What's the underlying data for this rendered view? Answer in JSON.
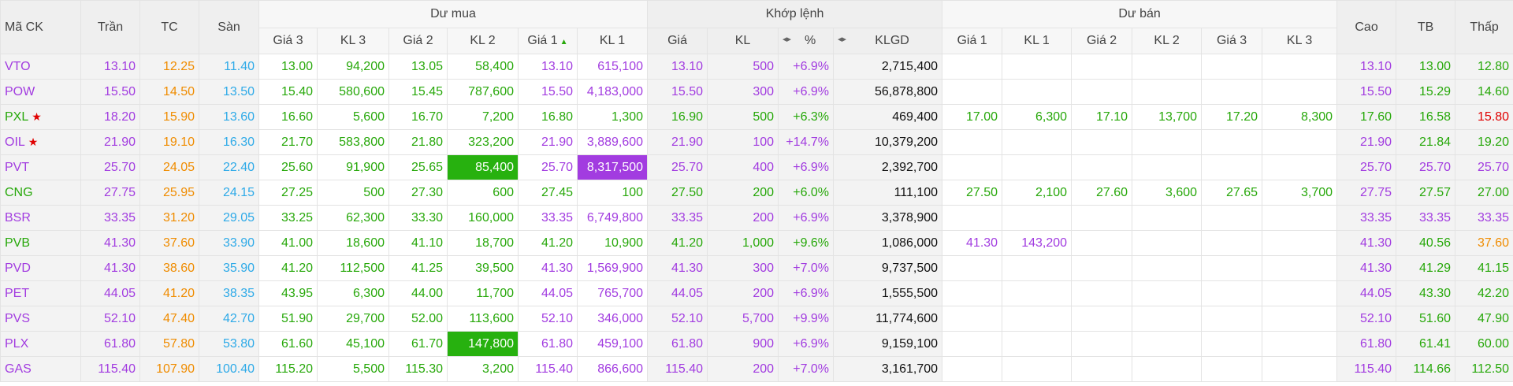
{
  "header": {
    "ma_ck": "Mã CK",
    "tran": "Trần",
    "tc": "TC",
    "san": "Sàn",
    "du_mua": "Dư mua",
    "khop_lenh": "Khớp lệnh",
    "du_ban": "Dư bán",
    "cao": "Cao",
    "tb": "TB",
    "thap": "Thấp",
    "gia3": "Giá 3",
    "kl3": "KL 3",
    "gia2": "Giá 2",
    "kl2": "KL 2",
    "gia1": "Giá 1",
    "kl1": "KL 1",
    "gia": "Giá",
    "kl": "KL",
    "pct": "%",
    "klgd": "KLGD",
    "sort_arrows": "◂▸",
    "sort_up": "▲"
  },
  "colors": {
    "ceiling": "#a23ce0",
    "reference": "#f08c00",
    "floor": "#2eaae8",
    "up": "#27a80a",
    "down": "#e00000",
    "flash_green": "#27b10f",
    "flash_purple": "#a23ce0"
  },
  "rows": [
    {
      "sym": "VTO",
      "star": "",
      "tran": "13.10",
      "tc": "12.25",
      "san": "11.40",
      "b_g3": "13.00",
      "b_k3": "94,200",
      "b_g2": "13.05",
      "b_k2": "58,400",
      "b_g1": "13.10",
      "b_k1": "615,100",
      "m_g": "13.10",
      "m_k": "500",
      "m_p": "+6.9%",
      "klgd": "2,715,400",
      "s_g1": "",
      "s_k1": "",
      "s_g2": "",
      "s_k2": "",
      "s_g3": "",
      "s_k3": "",
      "cao": "13.10",
      "tb": "13.00",
      "thap": "12.80"
    },
    {
      "sym": "POW",
      "star": "",
      "tran": "15.50",
      "tc": "14.50",
      "san": "13.50",
      "b_g3": "15.40",
      "b_k3": "580,600",
      "b_g2": "15.45",
      "b_k2": "787,600",
      "b_g1": "15.50",
      "b_k1": "4,183,000",
      "m_g": "15.50",
      "m_k": "300",
      "m_p": "+6.9%",
      "klgd": "56,878,800",
      "s_g1": "",
      "s_k1": "",
      "s_g2": "",
      "s_k2": "",
      "s_g3": "",
      "s_k3": "",
      "cao": "15.50",
      "tb": "15.29",
      "thap": "14.60"
    },
    {
      "sym": "PXL",
      "star": "★",
      "tran": "18.20",
      "tc": "15.90",
      "san": "13.60",
      "b_g3": "16.60",
      "b_k3": "5,600",
      "b_g2": "16.70",
      "b_k2": "7,200",
      "b_g1": "16.80",
      "b_k1": "1,300",
      "m_g": "16.90",
      "m_k": "500",
      "m_p": "+6.3%",
      "klgd": "469,400",
      "s_g1": "17.00",
      "s_k1": "6,300",
      "s_g2": "17.10",
      "s_k2": "13,700",
      "s_g3": "17.20",
      "s_k3": "8,300",
      "cao": "17.60",
      "tb": "16.58",
      "thap": "15.80"
    },
    {
      "sym": "OIL",
      "star": "★",
      "tran": "21.90",
      "tc": "19.10",
      "san": "16.30",
      "b_g3": "21.70",
      "b_k3": "583,800",
      "b_g2": "21.80",
      "b_k2": "323,200",
      "b_g1": "21.90",
      "b_k1": "3,889,600",
      "m_g": "21.90",
      "m_k": "100",
      "m_p": "+14.7%",
      "klgd": "10,379,200",
      "s_g1": "",
      "s_k1": "",
      "s_g2": "",
      "s_k2": "",
      "s_g3": "",
      "s_k3": "",
      "cao": "21.90",
      "tb": "21.84",
      "thap": "19.20"
    },
    {
      "sym": "PVT",
      "star": "",
      "tran": "25.70",
      "tc": "24.05",
      "san": "22.40",
      "b_g3": "25.60",
      "b_k3": "91,900",
      "b_g2": "25.65",
      "b_k2": "85,400",
      "b_g1": "25.70",
      "b_k1": "8,317,500",
      "m_g": "25.70",
      "m_k": "400",
      "m_p": "+6.9%",
      "klgd": "2,392,700",
      "s_g1": "",
      "s_k1": "",
      "s_g2": "",
      "s_k2": "",
      "s_g3": "",
      "s_k3": "",
      "cao": "25.70",
      "tb": "25.70",
      "thap": "25.70"
    },
    {
      "sym": "CNG",
      "star": "",
      "tran": "27.75",
      "tc": "25.95",
      "san": "24.15",
      "b_g3": "27.25",
      "b_k3": "500",
      "b_g2": "27.30",
      "b_k2": "600",
      "b_g1": "27.45",
      "b_k1": "100",
      "m_g": "27.50",
      "m_k": "200",
      "m_p": "+6.0%",
      "klgd": "111,100",
      "s_g1": "27.50",
      "s_k1": "2,100",
      "s_g2": "27.60",
      "s_k2": "3,600",
      "s_g3": "27.65",
      "s_k3": "3,700",
      "cao": "27.75",
      "tb": "27.57",
      "thap": "27.00"
    },
    {
      "sym": "BSR",
      "star": "",
      "tran": "33.35",
      "tc": "31.20",
      "san": "29.05",
      "b_g3": "33.25",
      "b_k3": "62,300",
      "b_g2": "33.30",
      "b_k2": "160,000",
      "b_g1": "33.35",
      "b_k1": "6,749,800",
      "m_g": "33.35",
      "m_k": "200",
      "m_p": "+6.9%",
      "klgd": "3,378,900",
      "s_g1": "",
      "s_k1": "",
      "s_g2": "",
      "s_k2": "",
      "s_g3": "",
      "s_k3": "",
      "cao": "33.35",
      "tb": "33.35",
      "thap": "33.35"
    },
    {
      "sym": "PVB",
      "star": "",
      "tran": "41.30",
      "tc": "37.60",
      "san": "33.90",
      "b_g3": "41.00",
      "b_k3": "18,600",
      "b_g2": "41.10",
      "b_k2": "18,700",
      "b_g1": "41.20",
      "b_k1": "10,900",
      "m_g": "41.20",
      "m_k": "1,000",
      "m_p": "+9.6%",
      "klgd": "1,086,000",
      "s_g1": "41.30",
      "s_k1": "143,200",
      "s_g2": "",
      "s_k2": "",
      "s_g3": "",
      "s_k3": "",
      "cao": "41.30",
      "tb": "40.56",
      "thap": "37.60"
    },
    {
      "sym": "PVD",
      "star": "",
      "tran": "41.30",
      "tc": "38.60",
      "san": "35.90",
      "b_g3": "41.20",
      "b_k3": "112,500",
      "b_g2": "41.25",
      "b_k2": "39,500",
      "b_g1": "41.30",
      "b_k1": "1,569,900",
      "m_g": "41.30",
      "m_k": "300",
      "m_p": "+7.0%",
      "klgd": "9,737,500",
      "s_g1": "",
      "s_k1": "",
      "s_g2": "",
      "s_k2": "",
      "s_g3": "",
      "s_k3": "",
      "cao": "41.30",
      "tb": "41.29",
      "thap": "41.15"
    },
    {
      "sym": "PET",
      "star": "",
      "tran": "44.05",
      "tc": "41.20",
      "san": "38.35",
      "b_g3": "43.95",
      "b_k3": "6,300",
      "b_g2": "44.00",
      "b_k2": "11,700",
      "b_g1": "44.05",
      "b_k1": "765,700",
      "m_g": "44.05",
      "m_k": "200",
      "m_p": "+6.9%",
      "klgd": "1,555,500",
      "s_g1": "",
      "s_k1": "",
      "s_g2": "",
      "s_k2": "",
      "s_g3": "",
      "s_k3": "",
      "cao": "44.05",
      "tb": "43.30",
      "thap": "42.20"
    },
    {
      "sym": "PVS",
      "star": "",
      "tran": "52.10",
      "tc": "47.40",
      "san": "42.70",
      "b_g3": "51.90",
      "b_k3": "29,700",
      "b_g2": "52.00",
      "b_k2": "113,600",
      "b_g1": "52.10",
      "b_k1": "346,000",
      "m_g": "52.10",
      "m_k": "5,700",
      "m_p": "+9.9%",
      "klgd": "11,774,600",
      "s_g1": "",
      "s_k1": "",
      "s_g2": "",
      "s_k2": "",
      "s_g3": "",
      "s_k3": "",
      "cao": "52.10",
      "tb": "51.60",
      "thap": "47.90"
    },
    {
      "sym": "PLX",
      "star": "",
      "tran": "61.80",
      "tc": "57.80",
      "san": "53.80",
      "b_g3": "61.60",
      "b_k3": "45,100",
      "b_g2": "61.70",
      "b_k2": "147,800",
      "b_g1": "61.80",
      "b_k1": "459,100",
      "m_g": "61.80",
      "m_k": "900",
      "m_p": "+6.9%",
      "klgd": "9,159,100",
      "s_g1": "",
      "s_k1": "",
      "s_g2": "",
      "s_k2": "",
      "s_g3": "",
      "s_k3": "",
      "cao": "61.80",
      "tb": "61.41",
      "thap": "60.00"
    },
    {
      "sym": "GAS",
      "star": "",
      "tran": "115.40",
      "tc": "107.90",
      "san": "100.40",
      "b_g3": "115.20",
      "b_k3": "5,500",
      "b_g2": "115.30",
      "b_k2": "3,200",
      "b_g1": "115.40",
      "b_k1": "866,600",
      "m_g": "115.40",
      "m_k": "200",
      "m_p": "+7.0%",
      "klgd": "3,161,700",
      "s_g1": "",
      "s_k1": "",
      "s_g2": "",
      "s_k2": "",
      "s_g3": "",
      "s_k3": "",
      "cao": "115.40",
      "tb": "114.66",
      "thap": "112.50"
    }
  ]
}
